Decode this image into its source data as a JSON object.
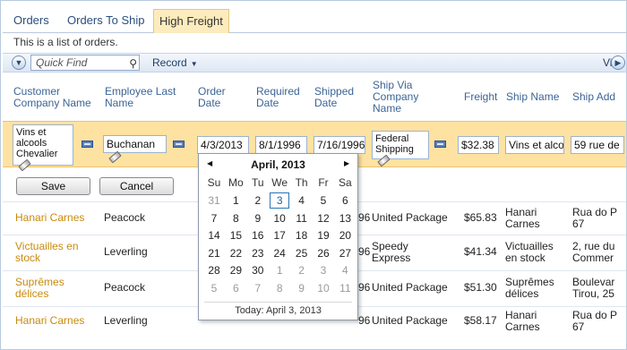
{
  "tabs": [
    "Orders",
    "Orders To Ship",
    "High Freight"
  ],
  "description": "This is a list of orders.",
  "toolbar": {
    "quick_find_placeholder": "Quick Find",
    "record_label": "Record",
    "view_label": "Vie"
  },
  "headers": {
    "customer": "Customer Company Name",
    "employee": "Employee Last Name",
    "order_date": "Order Date",
    "required_date": "Required Date",
    "shipped_date": "Shipped Date",
    "ship_via": "Ship Via Company Name",
    "freight": "Freight",
    "ship_name": "Ship Name",
    "ship_address": "Ship Add"
  },
  "edit_row": {
    "customer": "Vins et alcools Chevalier",
    "employee": "Buchanan",
    "order_date": "4/3/2013",
    "required_date": "8/1/1996",
    "shipped_date": "7/16/1996",
    "ship_via": "Federal Shipping",
    "freight": "$32.38",
    "ship_name": "Vins et alcools",
    "ship_address": "59 rue de"
  },
  "buttons": {
    "save": "Save",
    "cancel": "Cancel"
  },
  "rows": [
    {
      "customer": "Hanari Carnes",
      "employee": "Peacock",
      "shipped": "96",
      "ship_via": "United Package",
      "freight": "$65.83",
      "ship_name": "Hanari Carnes",
      "ship_address": "Rua do P 67"
    },
    {
      "customer": "Victuailles en stock",
      "employee": "Leverling",
      "shipped": "96",
      "ship_via": "Speedy Express",
      "freight": "$41.34",
      "ship_name": "Victuailles en stock",
      "ship_address": "2, rue du Commer"
    },
    {
      "customer": "Suprêmes délices",
      "employee": "Peacock",
      "shipped": "96",
      "ship_via": "United Package",
      "freight": "$51.30",
      "ship_name": "Suprêmes délices",
      "ship_address": "Boulevar Tirou, 25"
    },
    {
      "customer": "Hanari Carnes",
      "employee": "Leverling",
      "shipped": "96",
      "ship_via": "United Package",
      "freight": "$58.17",
      "ship_name": "Hanari Carnes",
      "ship_address": "Rua do P 67"
    }
  ],
  "calendar": {
    "title": "April, 2013",
    "dows": [
      "Su",
      "Mo",
      "Tu",
      "We",
      "Th",
      "Fr",
      "Sa"
    ],
    "weeks": [
      [
        "31",
        "1",
        "2",
        "3",
        "4",
        "5",
        "6"
      ],
      [
        "7",
        "8",
        "9",
        "10",
        "11",
        "12",
        "13"
      ],
      [
        "14",
        "15",
        "16",
        "17",
        "18",
        "19",
        "20"
      ],
      [
        "21",
        "22",
        "23",
        "24",
        "25",
        "26",
        "27"
      ],
      [
        "28",
        "29",
        "30",
        "1",
        "2",
        "3",
        "4"
      ],
      [
        "5",
        "6",
        "7",
        "8",
        "9",
        "10",
        "11"
      ]
    ],
    "selected": "3",
    "today": "Today: April 3, 2013"
  }
}
